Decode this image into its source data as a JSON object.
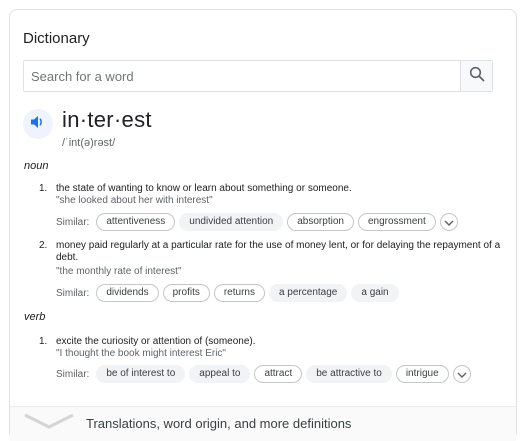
{
  "panel": {
    "title": "Dictionary"
  },
  "search": {
    "placeholder": "Search for a word",
    "icon": "search-icon"
  },
  "entry": {
    "word": "in·ter·est",
    "phonetic": "/ˈint(ə)rəst/",
    "pronounce_icon": "speaker-icon"
  },
  "noun": {
    "label": "noun",
    "senses": [
      {
        "number": "1.",
        "definition": "the state of wanting to know or learn about something or someone.",
        "example": "\"she looked about her with interest\"",
        "similar_label": "Similar:",
        "similar": [
          "attentiveness",
          "undivided attention",
          "absorption",
          "engrossment"
        ]
      },
      {
        "number": "2.",
        "definition": "money paid regularly at a particular rate for the use of money lent, or for delaying the repayment of a debt.",
        "example": "\"the monthly rate of interest\"",
        "similar_label": "Similar:",
        "similar": [
          "dividends",
          "profits",
          "returns",
          "a percentage",
          "a gain"
        ]
      }
    ]
  },
  "verb": {
    "label": "verb",
    "senses": [
      {
        "number": "1.",
        "definition": "excite the curiosity or attention of (someone).",
        "example": "\"I thought the book might interest Eric\"",
        "similar_label": "Similar:",
        "similar": [
          "be of interest to",
          "appeal to",
          "attract",
          "be attractive to",
          "intrigue"
        ]
      }
    ]
  },
  "footer": {
    "text": "Translations, word origin, and more definitions"
  },
  "colors": {
    "accent": "#1a73e8",
    "chip_fill": "#f1f3f4",
    "border": "#dfe1e5",
    "muted": "#5f6368"
  }
}
